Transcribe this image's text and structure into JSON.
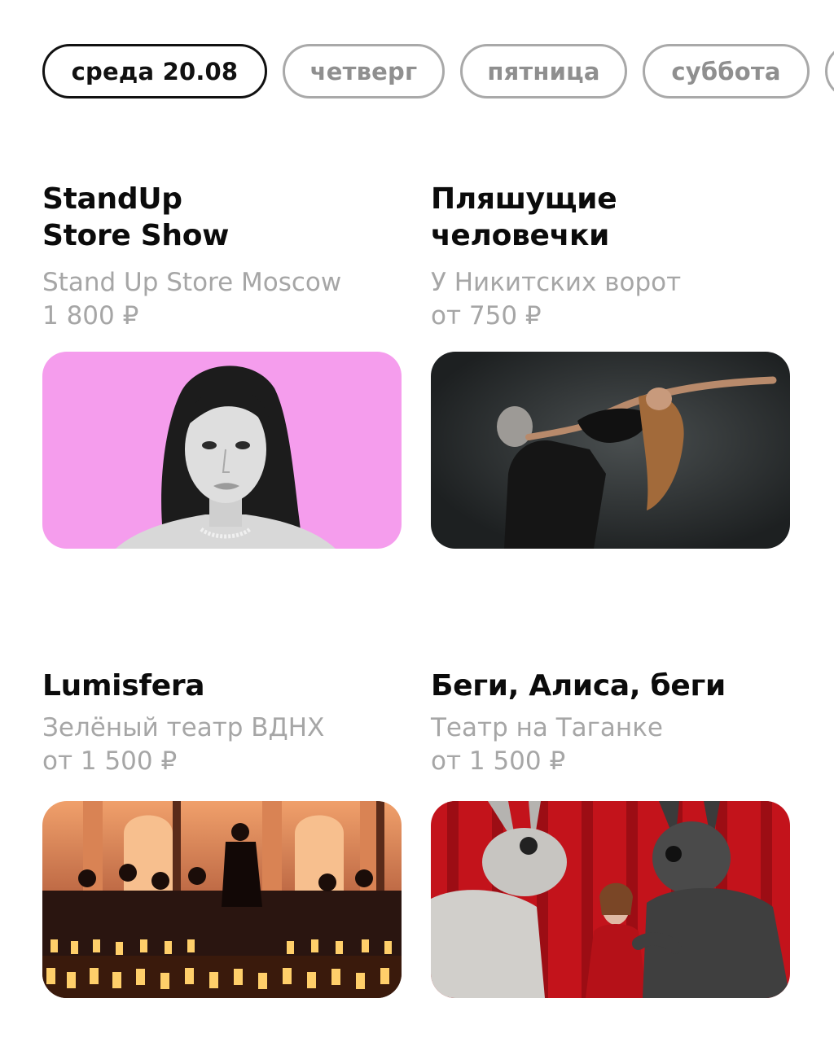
{
  "days": [
    {
      "label": "среда 20.08",
      "active": true
    },
    {
      "label": "четверг",
      "active": false
    },
    {
      "label": "пятница",
      "active": false
    },
    {
      "label": "суббота",
      "active": false
    },
    {
      "label": "",
      "active": false
    }
  ],
  "events": [
    {
      "title": "StandUp\nStore Show",
      "venue": "Stand Up Store Moscow",
      "price": "1 800 ₽",
      "image": "portrait-woman-pink-background",
      "image_bg": "#f59ded"
    },
    {
      "title": "Пляшущие\nчеловечки",
      "venue": "У Никитских ворот",
      "price": "от 750 ₽",
      "image": "dancing-couple-dark-stage",
      "image_bg": "#262a2b"
    },
    {
      "title": "Lumisfera",
      "venue": "Зелёный театр ВДНХ",
      "price": "от 1 500 ₽",
      "image": "orchestra-candles",
      "image_bg": "#e08a5c"
    },
    {
      "title": "Беги, Алиса, беги",
      "venue": "Театр на Таганке",
      "price": "от 1 500 ₽",
      "image": "rabbits-and-girl-red-curtain",
      "image_bg": "#c3131b"
    }
  ]
}
